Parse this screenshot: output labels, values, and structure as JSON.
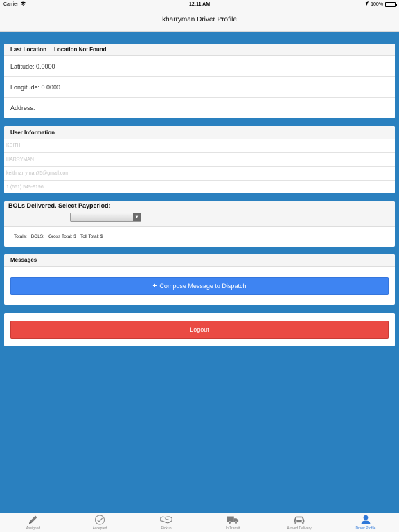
{
  "status_bar": {
    "carrier": "Carrier",
    "time": "12:11 AM",
    "battery": "100%"
  },
  "nav": {
    "title": "kharryman Driver Profile"
  },
  "location": {
    "header_label": "Last Location",
    "header_status": "Location Not Found",
    "latitude": "Latitude: 0.0000",
    "longitude": "Longitude: 0.0000",
    "address": "Address:"
  },
  "user_info": {
    "header": "User Information",
    "first_name": "KEITH",
    "last_name": "HARRYMAN",
    "email": "keithharryman75@gmail.com",
    "phone": "1 (661) 549-9196"
  },
  "bols": {
    "header": "BOLs Delivered. Select Payperiod:",
    "select_value": "",
    "totals_label": "Totals:",
    "bols_label": "BOLS:",
    "gross_label": "Gross Total: $",
    "toll_label": "Toll Total: $"
  },
  "messages": {
    "header": "Messages",
    "compose_icon": "+",
    "compose_label": "Compose Message to Dispatch"
  },
  "logout": {
    "label": "Logout"
  },
  "tabs": [
    {
      "label": "Assigned",
      "icon": "pencil-icon"
    },
    {
      "label": "Accepted",
      "icon": "checkmark-icon"
    },
    {
      "label": "Pickup",
      "icon": "handshake-icon"
    },
    {
      "label": "In Transit",
      "icon": "truck-icon"
    },
    {
      "label": "Arrived Delivery",
      "icon": "car-icon"
    },
    {
      "label": "Driver Profile",
      "icon": "person-icon"
    }
  ],
  "colors": {
    "background": "#2a80bf",
    "compose_button": "#3e84f2",
    "logout_button": "#ea4a43",
    "active_tab": "#2f78d8"
  }
}
